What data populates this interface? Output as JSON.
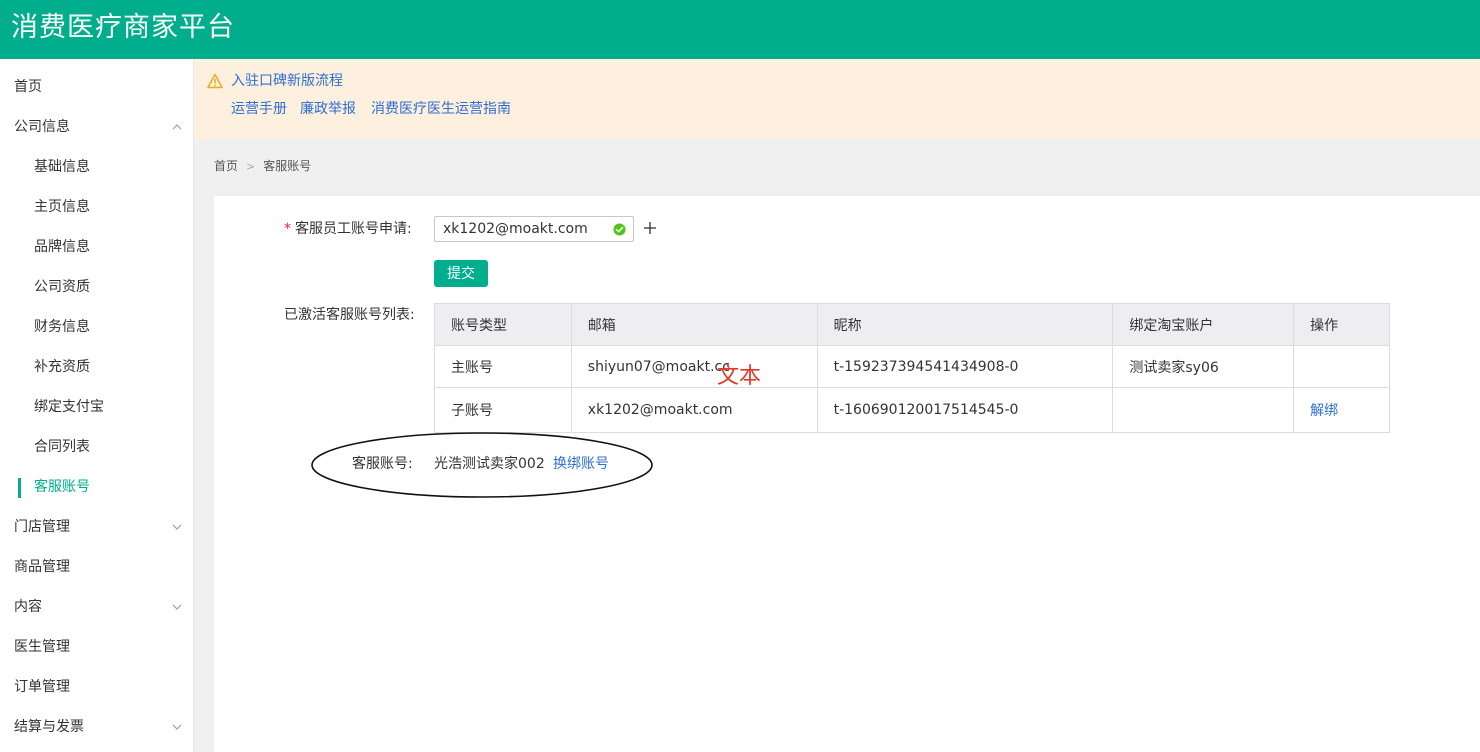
{
  "app": {
    "title": "消费医疗商家平台"
  },
  "colors": {
    "brand": "#00ad8d",
    "link": "#2f6fd0",
    "warning": "#f5a623",
    "notice_bg": "#fdf0df",
    "annotation": "#e03a2a"
  },
  "sidebar": {
    "items": [
      {
        "label": "首页",
        "level": 1,
        "chevron": ""
      },
      {
        "label": "公司信息",
        "level": 1,
        "chevron": "up"
      },
      {
        "label": "基础信息",
        "level": 2
      },
      {
        "label": "主页信息",
        "level": 2
      },
      {
        "label": "品牌信息",
        "level": 2
      },
      {
        "label": "公司资质",
        "level": 2
      },
      {
        "label": "财务信息",
        "level": 2
      },
      {
        "label": "补充资质",
        "level": 2
      },
      {
        "label": "绑定支付宝",
        "level": 2
      },
      {
        "label": "合同列表",
        "level": 2
      },
      {
        "label": "客服账号",
        "level": 2,
        "active": true
      },
      {
        "label": "门店管理",
        "level": 1,
        "chevron": "down"
      },
      {
        "label": "商品管理",
        "level": 1,
        "chevron": ""
      },
      {
        "label": "内容",
        "level": 1,
        "chevron": "down"
      },
      {
        "label": "医生管理",
        "level": 1,
        "chevron": ""
      },
      {
        "label": "订单管理",
        "level": 1,
        "chevron": ""
      },
      {
        "label": "结算与发票",
        "level": 1,
        "chevron": "down"
      }
    ]
  },
  "notice": {
    "icon": "warning-icon",
    "main_link": "入驻口碑新版流程",
    "links": [
      "运营手册",
      "廉政举报",
      "消费医疗医生运营指南"
    ]
  },
  "breadcrumb": {
    "home": "首页",
    "current": "客服账号"
  },
  "form": {
    "apply_label": "客服员工账号申请:",
    "email_value": "xk1202@moakt.com",
    "submit_label": "提交",
    "list_label": "已激活客服账号列表:"
  },
  "table": {
    "headers": [
      "账号类型",
      "邮箱",
      "昵称",
      "绑定淘宝账户",
      "操作"
    ],
    "rows": [
      {
        "type": "主账号",
        "email": "shiyun07@moakt.cc",
        "nickname": "t-159237394541434908-0",
        "taobao": "测试卖家sy06",
        "action": ""
      },
      {
        "type": "子账号",
        "email": "xk1202@moakt.com",
        "nickname": "t-160690120017514545-0",
        "taobao": "",
        "action": "解绑"
      }
    ]
  },
  "annotation": {
    "text": "文本"
  },
  "customer_service": {
    "label": "客服账号:",
    "value": "光浩测试卖家002",
    "rebind_link": "换绑账号"
  }
}
